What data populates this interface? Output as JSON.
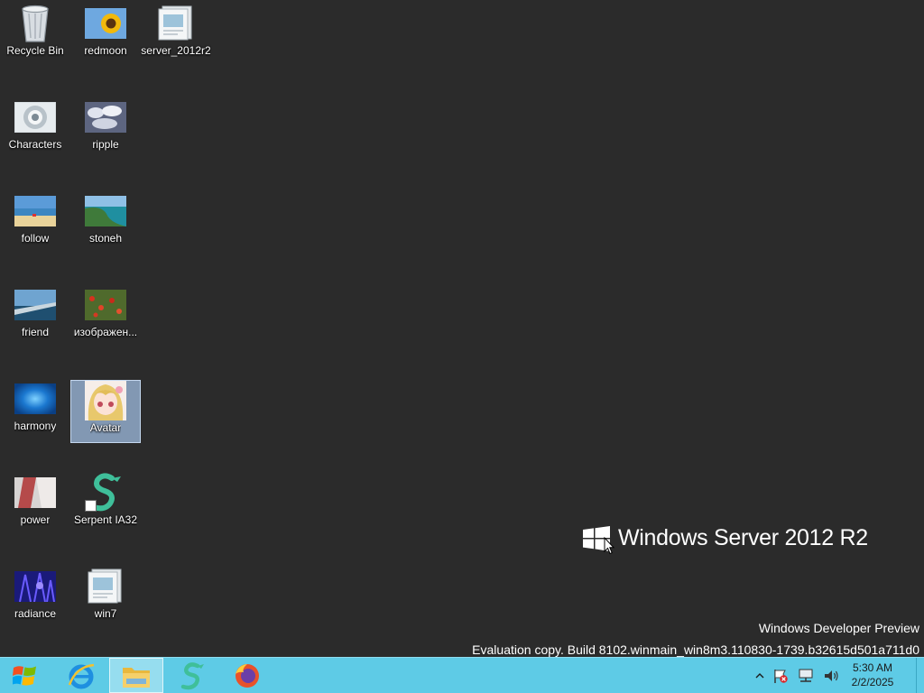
{
  "desktop": {
    "background_color": "#2b2b2b",
    "icons": [
      {
        "label": "Recycle Bin",
        "icon": "recycle-bin-icon"
      },
      {
        "label": "redmoon",
        "icon": "sunflower-image-icon"
      },
      {
        "label": "server_2012r2",
        "icon": "document-image-icon"
      },
      {
        "label": "Characters",
        "icon": "characters-image-icon"
      },
      {
        "label": "ripple",
        "icon": "ripple-image-icon"
      },
      {
        "label": "follow",
        "icon": "beach-image-icon"
      },
      {
        "label": "stoneh",
        "icon": "coast-image-icon"
      },
      {
        "label": "friend",
        "icon": "pier-image-icon"
      },
      {
        "label": "изображен...",
        "icon": "flowers-image-icon"
      },
      {
        "label": "harmony",
        "icon": "blue-wallpaper-icon"
      },
      {
        "label": "Avatar",
        "icon": "anime-avatar-icon",
        "selected": true
      },
      {
        "label": "power",
        "icon": "power-image-icon"
      },
      {
        "label": "Serpent IA32",
        "icon": "serpent-app-icon"
      },
      {
        "label": "radiance",
        "icon": "radiance-image-icon"
      },
      {
        "label": "win7",
        "icon": "document-image-icon"
      }
    ]
  },
  "brand": {
    "logo": "windows-logo-icon",
    "name": "Windows Server 2012 R2"
  },
  "watermark": {
    "line1": "Windows Developer Preview",
    "line2": "Evaluation copy. Build 8102.winmain_win8m3.110830-1739.b32615d501a711d0"
  },
  "taskbar": {
    "color": "#5ecbe6",
    "start": {
      "icon": "windows-start-icon"
    },
    "pinned": [
      {
        "name": "Internet Explorer",
        "icon": "internet-explorer-icon"
      },
      {
        "name": "File Explorer",
        "icon": "file-explorer-icon",
        "active": true
      },
      {
        "name": "Serpent IA32",
        "icon": "serpent-app-icon"
      },
      {
        "name": "Firefox",
        "icon": "firefox-icon"
      }
    ],
    "tray": [
      "show-hidden-icons-icon",
      "action-center-flag-icon",
      "network-icon",
      "volume-icon"
    ],
    "clock": {
      "time": "5:30 AM",
      "date": "2/2/2025"
    }
  }
}
